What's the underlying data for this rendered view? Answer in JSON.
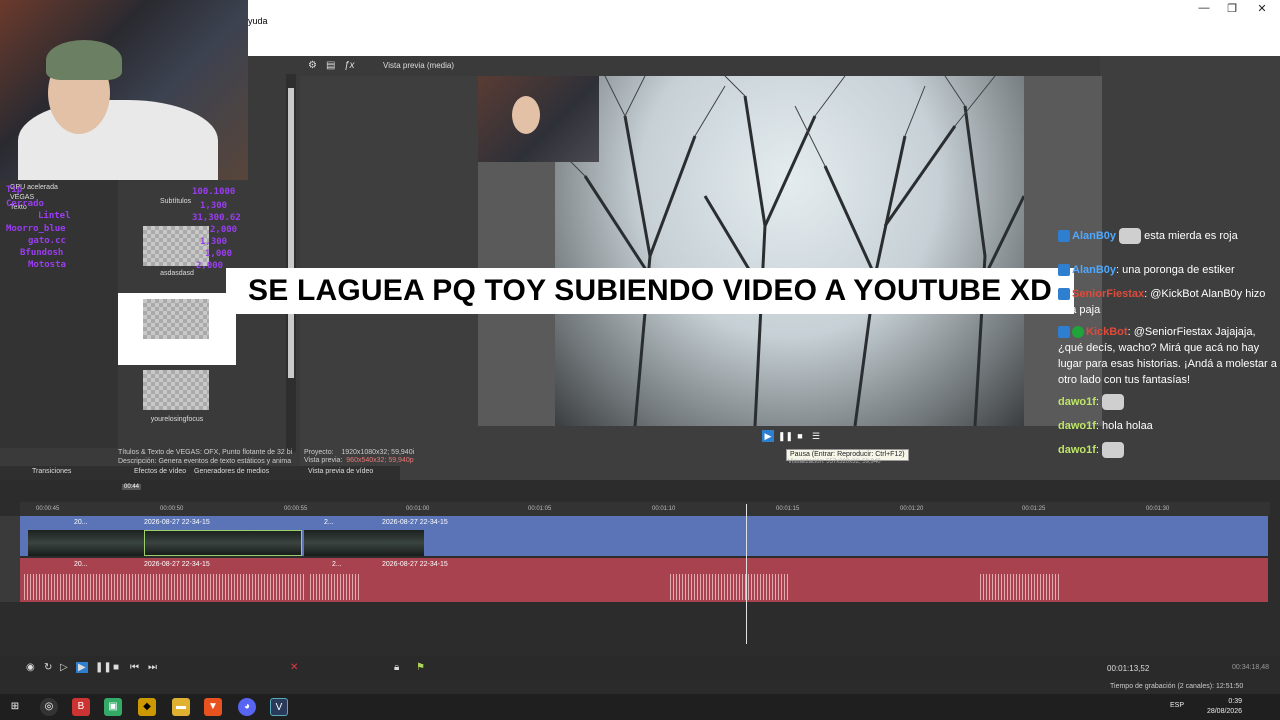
{
  "window": {
    "menu_fragment": "yuda",
    "controls": [
      "—",
      "❐",
      "✕"
    ]
  },
  "left_pane": {
    "tree": [
      "GPU acelerada",
      "VEGAS",
      "Texto"
    ],
    "media_header": "Subtítulos",
    "media_items": [
      {
        "label": "asdasdasd"
      },
      {
        "label": ""
      },
      {
        "label": "yourelosingfocus"
      }
    ],
    "description_line1": "Títulos & Texto de VEGAS: OFX, Punto flotante de 32 bi",
    "description_line2": "Descripción: Genera eventos de texto estáticos y anima",
    "tabs": [
      "Transiciones",
      "Efectos de vídeo",
      "Generadores de medios"
    ]
  },
  "overlay_purple_left": [
    "Tip",
    "Cerrado",
    "Lintel",
    "Moorro_blue",
    "gato.cc",
    "Bfundosh",
    "Motosta"
  ],
  "overlay_purple_right": [
    "100.1000",
    "1,300",
    "31,300.62",
    "2,000",
    "1,300",
    "1,000",
    "2,000"
  ],
  "preview": {
    "toolbar_label": "Vista previa (media)",
    "caption": "SE LAGUEA PQ TOY SUBIENDO VIDEO A YOUTUBE XD",
    "tooltip": "Pausa (Entrar: Reproducir: Ctrl+F12)",
    "project_label": "Proyecto:",
    "project_value": "1920x1080x32; 59,940i",
    "preview_label": "Vista previa:",
    "preview_value": "960x540x32; 59,940p",
    "display_label": "Visualización:",
    "display_value": "557x320x32; 59,940",
    "tab": "Vista previa de vídeo"
  },
  "chat": [
    {
      "nick": "AlanB0y",
      "color": "#4fa8ff",
      "text": "una poronga de estiker",
      "badge": "twitch"
    },
    {
      "nick": "SeniorFiestax",
      "color": "#e04a3a",
      "text": "@KickBot AlanB0y hizo una paja",
      "badge": "twitch"
    },
    {
      "nick": "KickBot",
      "color": "#e04a3a",
      "text": "@SeniorFiestax Jajajaja, ¿qué decís, wacho? Mirá que acá no hay lugar para esas historias. ¡Andá a molestar a otro lado con tus fantasías!",
      "badge": "verified"
    },
    {
      "nick": "dawo1f",
      "color": "#bfe46a",
      "text": "",
      "emote": true
    },
    {
      "nick": "dawo1f",
      "color": "#bfe46a",
      "text": "hola holaa"
    },
    {
      "nick": "dawo1f",
      "color": "#bfe46a",
      "text": "",
      "emote": true
    }
  ],
  "chat_top": {
    "nick": "AlanB0y",
    "text": "esta mierda es roja"
  },
  "timeline": {
    "small_counter": "00:44",
    "ruler": [
      "00:00:45",
      "00:00:50",
      "00:00:55",
      "00:01:00",
      "00:01:05",
      "00:01:10",
      "00:01:15",
      "00:01:20",
      "00:01:25",
      "00:01:30"
    ],
    "video_clips": [
      "2026-08-27 22-34-15",
      "20...",
      "2026-08-27 22-34-15",
      "2...",
      "2026-08-27 22-34-15"
    ],
    "audio_clips": [
      "2026-08-27 22-34-15",
      "20...",
      "2026-08-27 22-34-15",
      "2...",
      "2026-08-27 22-34-15"
    ],
    "timecode": "00:01:13,52",
    "end_timecode": "00:34:18,48",
    "record_info": "Tiempo de grabación (2 canales): 12:51:50"
  },
  "taskbar": {
    "lang": "ESP",
    "time": "0:39",
    "date": "28/08/2026"
  },
  "colors": {
    "video_track": "#5b74b7",
    "audio_track": "#a9424f",
    "overlay_purple": "#9a3df0"
  }
}
